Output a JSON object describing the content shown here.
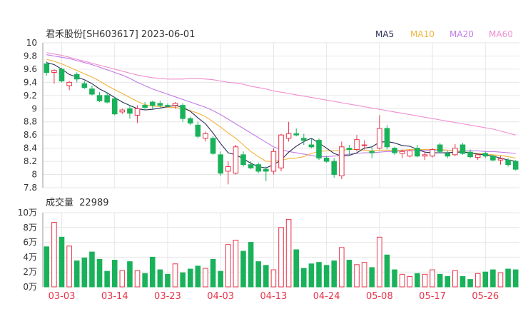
{
  "colors": {
    "up": "#e8344a",
    "down": "#19b25a",
    "ma5": "#2b2d55",
    "ma10": "#f0b43c",
    "ma20": "#c27ce6",
    "ma60": "#f08ecf",
    "grid": "#e6e6e6",
    "axis": "#555555",
    "date": "#e8344a"
  },
  "chart_data": [
    {
      "type": "candlestick",
      "title": "君禾股份[SH603617] 2023-06-01",
      "legend": [
        "MA5",
        "MA10",
        "MA20",
        "MA60"
      ],
      "legend_position": "top-right",
      "grid": true,
      "ylim": [
        7.8,
        10
      ],
      "yticks": [
        "10",
        "9.8",
        "9.6",
        "9.4",
        "9.2",
        "9",
        "8.8",
        "8.6",
        "8.4",
        "8.2",
        "8",
        "7.8"
      ],
      "dates": [
        "03-01",
        "03-02",
        "03-03",
        "03-06",
        "03-07",
        "03-08",
        "03-09",
        "03-10",
        "03-13",
        "03-14",
        "03-15",
        "03-16",
        "03-17",
        "03-20",
        "03-21",
        "03-22",
        "03-23",
        "03-24",
        "03-27",
        "03-28",
        "03-29",
        "03-30",
        "03-31",
        "04-03",
        "04-04",
        "04-06",
        "04-07",
        "04-10",
        "04-11",
        "04-12",
        "04-13",
        "04-14",
        "04-17",
        "04-18",
        "04-19",
        "04-20",
        "04-21",
        "04-24",
        "04-25",
        "04-26",
        "04-27",
        "04-28",
        "05-04",
        "05-05",
        "05-08",
        "05-09",
        "05-10",
        "05-11",
        "05-12",
        "05-15",
        "05-16",
        "05-17",
        "05-18",
        "05-19",
        "05-22",
        "05-23",
        "05-24",
        "05-25",
        "05-26",
        "05-29",
        "05-30",
        "05-31",
        "06-01"
      ],
      "x_tick_labels": [
        "03-03",
        "03-14",
        "03-23",
        "04-03",
        "04-13",
        "04-24",
        "05-08",
        "05-17",
        "05-26"
      ],
      "x_tick_indices": [
        2,
        9,
        16,
        23,
        30,
        37,
        44,
        51,
        58
      ],
      "ohlc": [
        [
          9.68,
          9.72,
          9.5,
          9.55
        ],
        [
          9.55,
          9.6,
          9.38,
          9.58
        ],
        [
          9.6,
          9.62,
          9.4,
          9.42
        ],
        [
          9.35,
          9.42,
          9.28,
          9.4
        ],
        [
          9.52,
          9.55,
          9.4,
          9.45
        ],
        [
          9.38,
          9.42,
          9.3,
          9.32
        ],
        [
          9.3,
          9.35,
          9.2,
          9.22
        ],
        [
          9.2,
          9.25,
          9.1,
          9.12
        ],
        [
          9.2,
          9.25,
          9.08,
          9.1
        ],
        [
          9.15,
          9.18,
          8.9,
          8.92
        ],
        [
          8.95,
          9.0,
          8.92,
          8.98
        ],
        [
          9.0,
          9.05,
          8.85,
          8.93
        ],
        [
          8.9,
          9.05,
          8.78,
          9.0
        ],
        [
          9.05,
          9.1,
          8.98,
          9.02
        ],
        [
          9.1,
          9.12,
          9.0,
          9.05
        ],
        [
          9.08,
          9.12,
          9.02,
          9.05
        ],
        [
          9.05,
          9.08,
          9.02,
          9.04
        ],
        [
          9.05,
          9.1,
          9.0,
          9.08
        ],
        [
          9.05,
          9.08,
          8.8,
          8.85
        ],
        [
          8.85,
          8.88,
          8.75,
          8.78
        ],
        [
          8.75,
          8.8,
          8.55,
          8.58
        ],
        [
          8.55,
          8.65,
          8.5,
          8.62
        ],
        [
          8.55,
          8.58,
          8.3,
          8.32
        ],
        [
          8.3,
          8.35,
          7.98,
          8.02
        ],
        [
          8.05,
          8.2,
          7.85,
          8.12
        ],
        [
          8.02,
          8.45,
          8.0,
          8.42
        ],
        [
          8.3,
          8.35,
          8.12,
          8.15
        ],
        [
          8.15,
          8.2,
          8.08,
          8.1
        ],
        [
          8.15,
          8.18,
          8.02,
          8.05
        ],
        [
          8.08,
          8.12,
          7.9,
          8.05
        ],
        [
          8.05,
          8.4,
          8.0,
          8.35
        ],
        [
          8.1,
          8.62,
          8.05,
          8.6
        ],
        [
          8.55,
          8.8,
          8.5,
          8.62
        ],
        [
          8.62,
          8.7,
          8.58,
          8.6
        ],
        [
          8.55,
          8.62,
          8.45,
          8.52
        ],
        [
          8.45,
          8.55,
          8.4,
          8.42
        ],
        [
          8.52,
          8.55,
          8.22,
          8.25
        ],
        [
          8.25,
          8.28,
          8.18,
          8.2
        ],
        [
          8.2,
          8.25,
          7.95,
          8.0
        ],
        [
          7.98,
          8.5,
          7.93,
          8.42
        ],
        [
          8.4,
          8.45,
          8.3,
          8.38
        ],
        [
          8.38,
          8.6,
          8.35,
          8.53
        ],
        [
          8.45,
          8.52,
          8.38,
          8.45
        ],
        [
          8.35,
          8.42,
          8.25,
          8.33
        ],
        [
          8.4,
          8.9,
          8.38,
          8.7
        ],
        [
          8.7,
          8.75,
          8.38,
          8.42
        ],
        [
          8.4,
          8.42,
          8.3,
          8.33
        ],
        [
          8.32,
          8.38,
          8.25,
          8.35
        ],
        [
          8.28,
          8.38,
          8.26,
          8.36
        ],
        [
          8.4,
          8.45,
          8.26,
          8.28
        ],
        [
          8.28,
          8.35,
          8.22,
          8.3
        ],
        [
          8.28,
          8.4,
          8.26,
          8.38
        ],
        [
          8.45,
          8.48,
          8.32,
          8.35
        ],
        [
          8.32,
          8.36,
          8.25,
          8.28
        ],
        [
          8.3,
          8.46,
          8.28,
          8.4
        ],
        [
          8.45,
          8.48,
          8.3,
          8.32
        ],
        [
          8.34,
          8.38,
          8.25,
          8.27
        ],
        [
          8.26,
          8.32,
          8.22,
          8.3
        ],
        [
          8.32,
          8.35,
          8.25,
          8.28
        ],
        [
          8.28,
          8.3,
          8.2,
          8.22
        ],
        [
          8.22,
          8.28,
          8.15,
          8.24
        ],
        [
          8.22,
          8.25,
          8.12,
          8.15
        ],
        [
          8.2,
          8.22,
          8.06,
          8.08
        ]
      ],
      "ma5": [
        9.7,
        9.67,
        9.6,
        9.52,
        9.48,
        9.44,
        9.38,
        9.3,
        9.24,
        9.17,
        9.1,
        9.05,
        9.0,
        8.98,
        8.99,
        9.01,
        9.03,
        9.05,
        9.02,
        8.96,
        8.86,
        8.77,
        8.63,
        8.47,
        8.33,
        8.3,
        8.24,
        8.17,
        8.12,
        8.1,
        8.15,
        8.22,
        8.34,
        8.43,
        8.5,
        8.55,
        8.48,
        8.4,
        8.32,
        8.28,
        8.29,
        8.33,
        8.4,
        8.42,
        8.49,
        8.5,
        8.48,
        8.44,
        8.43,
        8.38,
        8.34,
        8.33,
        8.33,
        8.33,
        8.34,
        8.34,
        8.33,
        8.31,
        8.3,
        8.28,
        8.25,
        8.22,
        8.2
      ],
      "ma10": [
        9.75,
        9.72,
        9.68,
        9.63,
        9.58,
        9.53,
        9.48,
        9.42,
        9.35,
        9.29,
        9.23,
        9.17,
        9.11,
        9.06,
        9.04,
        9.03,
        9.02,
        9.02,
        9.0,
        8.97,
        8.93,
        8.88,
        8.8,
        8.72,
        8.63,
        8.55,
        8.45,
        8.35,
        8.27,
        8.2,
        8.2,
        8.22,
        8.24,
        8.25,
        8.27,
        8.32,
        8.35,
        8.36,
        8.36,
        8.37,
        8.38,
        8.38,
        8.37,
        8.36,
        8.37,
        8.37,
        8.37,
        8.37,
        8.38,
        8.38,
        8.38,
        8.38,
        8.38,
        8.37,
        8.36,
        8.35,
        8.33,
        8.32,
        8.31,
        8.3,
        8.29,
        8.27,
        8.25
      ],
      "ma20": [
        9.82,
        9.8,
        9.78,
        9.76,
        9.73,
        9.7,
        9.67,
        9.63,
        9.59,
        9.55,
        9.51,
        9.46,
        9.4,
        9.35,
        9.3,
        9.26,
        9.22,
        9.18,
        9.14,
        9.1,
        9.06,
        9.02,
        8.97,
        8.91,
        8.84,
        8.77,
        8.7,
        8.63,
        8.56,
        8.49,
        8.42,
        8.38,
        8.35,
        8.33,
        8.31,
        8.29,
        8.27,
        8.27,
        8.28,
        8.29,
        8.31,
        8.32,
        8.33,
        8.33,
        8.34,
        8.35,
        8.35,
        8.36,
        8.36,
        8.37,
        8.37,
        8.37,
        8.37,
        8.37,
        8.36,
        8.36,
        8.36,
        8.36,
        8.35,
        8.35,
        8.34,
        8.33,
        8.32
      ],
      "ma60": [
        9.85,
        9.83,
        9.81,
        9.78,
        9.75,
        9.72,
        9.69,
        9.66,
        9.63,
        9.6,
        9.57,
        9.54,
        9.51,
        9.49,
        9.47,
        9.46,
        9.45,
        9.45,
        9.45,
        9.46,
        9.46,
        9.45,
        9.44,
        9.42,
        9.4,
        9.39,
        9.37,
        9.34,
        9.32,
        9.3,
        9.27,
        9.25,
        9.23,
        9.21,
        9.19,
        9.17,
        9.15,
        9.13,
        9.11,
        9.09,
        9.07,
        9.05,
        9.03,
        9.01,
        8.99,
        8.97,
        8.95,
        8.93,
        8.91,
        8.89,
        8.87,
        8.85,
        8.83,
        8.81,
        8.79,
        8.77,
        8.75,
        8.73,
        8.71,
        8.69,
        8.66,
        8.63,
        8.6
      ]
    },
    {
      "type": "bar",
      "title": "成交量",
      "latest_label": "22989",
      "ylim": [
        0,
        100000
      ],
      "ytick_labels": [
        "10万",
        "8万",
        "6万",
        "4万",
        "2万",
        "0万"
      ],
      "ytick_values": [
        100000,
        80000,
        60000,
        40000,
        20000,
        0
      ],
      "volume": [
        54000,
        87000,
        67000,
        55000,
        35000,
        39000,
        47000,
        37000,
        21000,
        36000,
        22000,
        34000,
        22000,
        18000,
        40000,
        23000,
        17000,
        31000,
        19000,
        24000,
        28000,
        25000,
        37000,
        21000,
        57000,
        63000,
        48000,
        60000,
        34000,
        29000,
        23000,
        80000,
        91000,
        50000,
        25000,
        31000,
        33000,
        29000,
        35000,
        53000,
        36000,
        30000,
        33000,
        26000,
        67000,
        43000,
        23000,
        17000,
        14000,
        18000,
        17000,
        23000,
        17000,
        14000,
        22000,
        14000,
        10000,
        18000,
        20000,
        23000,
        19000,
        24000,
        23000
      ]
    }
  ],
  "header": {
    "title": "君禾股份[SH603617] 2023-06-01",
    "legend": {
      "ma5": "MA5",
      "ma10": "MA10",
      "ma20": "MA20",
      "ma60": "MA60"
    }
  },
  "volume_header": {
    "label": "成交量",
    "value": "22989"
  }
}
